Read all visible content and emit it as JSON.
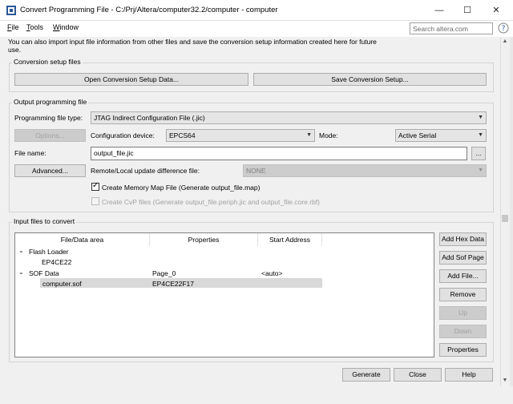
{
  "window": {
    "title": "Convert Programming File - C:/Prj/Altera/computer32.2/computer - computer",
    "controls": {
      "minimize": "—",
      "maximize": "☐",
      "close": "✕"
    }
  },
  "menu": {
    "items": [
      "File",
      "Tools",
      "Window"
    ]
  },
  "search": {
    "placeholder": "Search altera.com"
  },
  "info": {
    "text": "You can also import input file information from other files and save the conversion setup information created here for future use."
  },
  "conversion_setup": {
    "title": "Conversion setup files",
    "open_label": "Open Conversion Setup Data...",
    "save_label": "Save Conversion Setup..."
  },
  "output": {
    "title": "Output programming file",
    "file_type_label": "Programming file type:",
    "file_type_value": "JTAG Indirect Configuration File (.jic)",
    "options_label": "Options...",
    "config_device_label": "Configuration device:",
    "config_device_value": "EPCS64",
    "mode_label": "Mode:",
    "mode_value": "Active Serial",
    "file_name_label": "File name:",
    "file_name_value": "output_file.jic",
    "browse_label": "...",
    "advanced_label": "Advanced...",
    "update_diff_label": "Remote/Local update difference file:",
    "update_diff_value": "NONE",
    "memory_map_label": "Create Memory Map File (Generate output_file.map)",
    "memory_map_checked": true,
    "cvp_label": "Create CvP files (Generate output_file.periph.jic and output_file.core.rbf)",
    "cvp_checked": false
  },
  "input_files": {
    "title": "Input files to convert",
    "columns": [
      "File/Data area",
      "Properties",
      "Start Address"
    ],
    "tree": {
      "flash_loader": {
        "label": "Flash Loader",
        "child": "EP4CE22"
      },
      "sof_data": {
        "label": "SOF Data",
        "properties": "Page_0",
        "start_address": "<auto>",
        "child": {
          "file": "computer.sof",
          "properties": "EP4CE22F17"
        }
      }
    },
    "buttons": {
      "add_hex": "Add Hex Data",
      "add_sof_page": "Add Sof Page",
      "add_file": "Add File...",
      "remove": "Remove",
      "up": "Up",
      "down": "Down",
      "properties": "Properties"
    }
  },
  "footer": {
    "generate": "Generate",
    "close": "Close",
    "help": "Help"
  },
  "icons": {
    "app": "quartus-app-icon",
    "help": "help-circle-icon",
    "expand": "expand-arrow-icon",
    "dropdown": "chevron-down-icon"
  }
}
